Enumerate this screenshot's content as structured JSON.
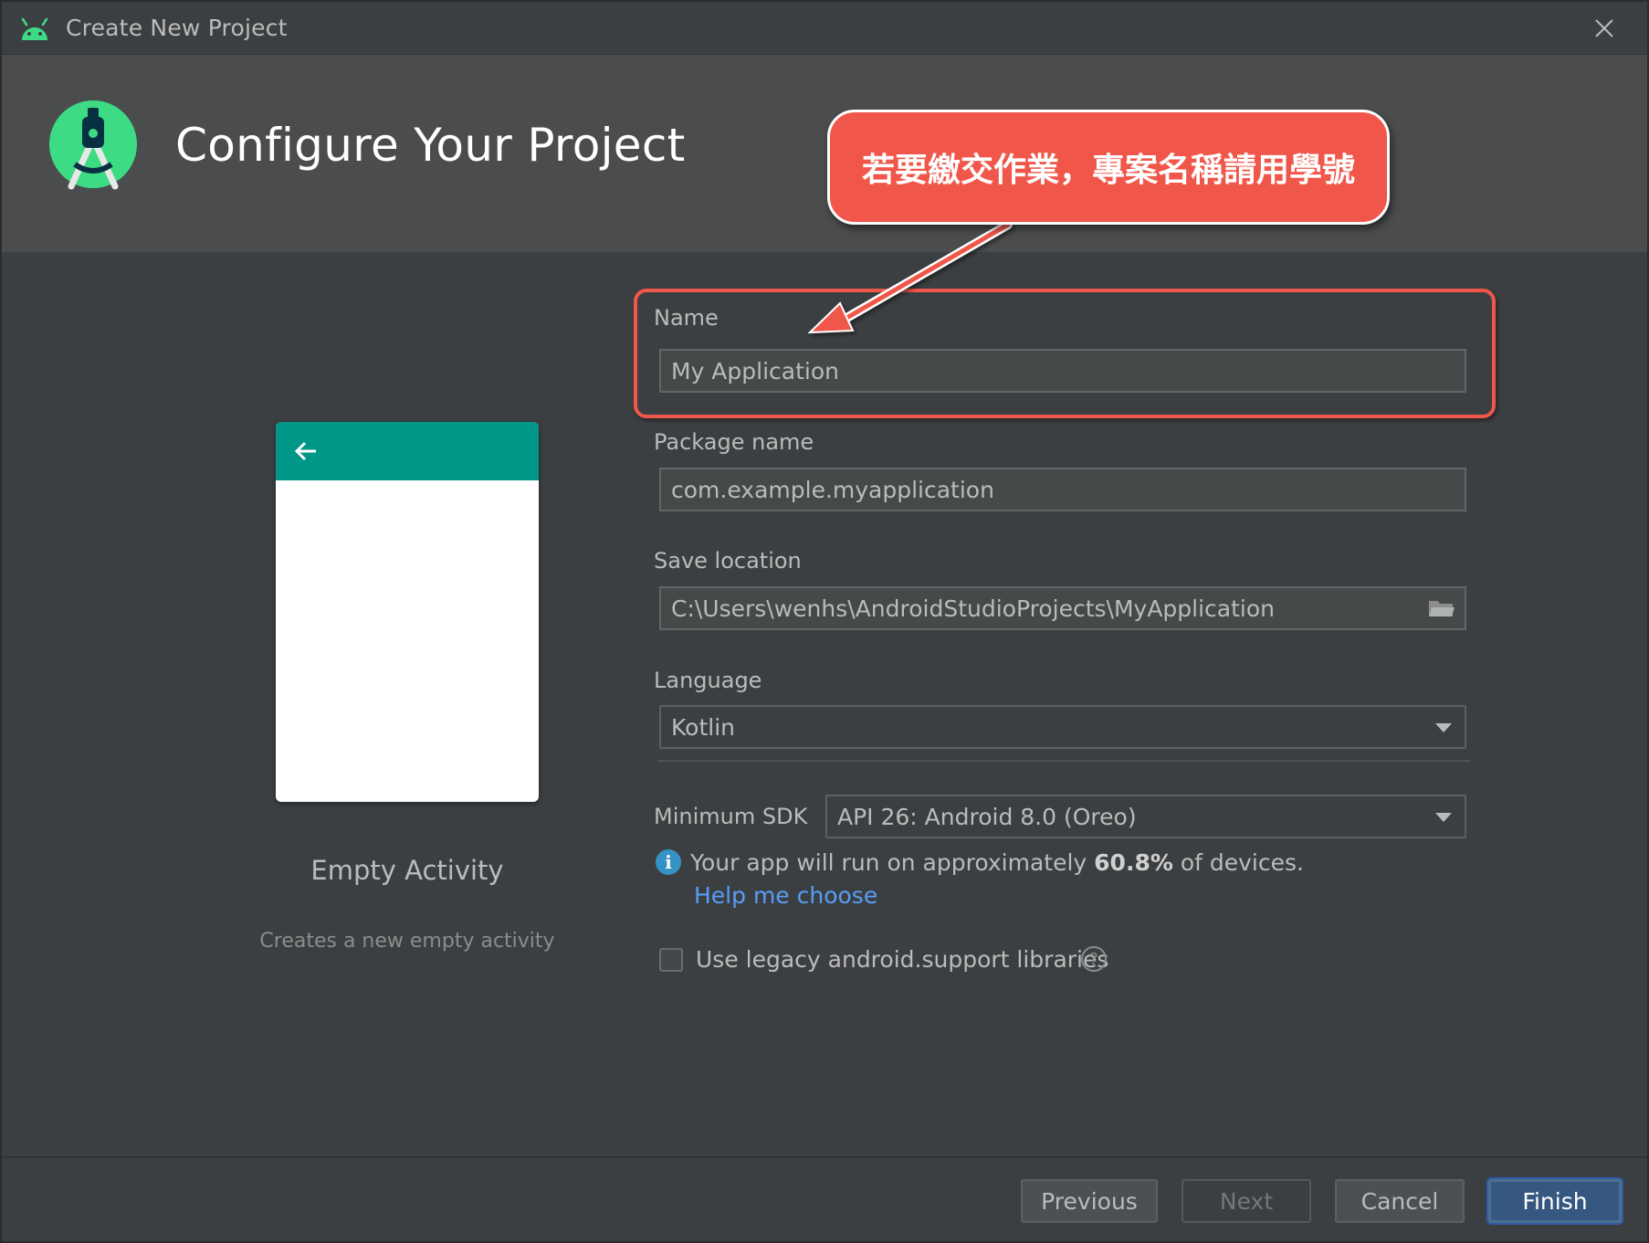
{
  "window": {
    "title": "Create New Project"
  },
  "header": {
    "heading": "Configure Your Project"
  },
  "callout": {
    "text": "若要繳交作業，專案名稱請用學號",
    "color": "#f0574a"
  },
  "template_preview": {
    "appbar_color": "#009688",
    "activity_title": "Empty Activity",
    "activity_description": "Creates a new empty activity"
  },
  "form": {
    "name_label": "Name",
    "name_value": "My Application",
    "package_label": "Package name",
    "package_value": "com.example.myapplication",
    "save_location_label": "Save location",
    "save_location_value": "C:\\Users\\wenhs\\AndroidStudioProjects\\MyApplication",
    "language_label": "Language",
    "language_value": "Kotlin",
    "min_sdk_label": "Minimum SDK",
    "min_sdk_value": "API 26: Android 8.0 (Oreo)",
    "info_prefix": "Your app will run on approximately ",
    "info_percent": "60.8%",
    "info_suffix": " of devices.",
    "help_link": "Help me choose",
    "legacy_checkbox_label": "Use legacy android.support libraries",
    "legacy_checked": false
  },
  "footer": {
    "previous": "Previous",
    "next": "Next",
    "cancel": "Cancel",
    "finish": "Finish"
  },
  "icons": {
    "app": "android-icon",
    "logo": "android-studio-logo-icon",
    "close": "close-icon",
    "back": "arrow-left-icon",
    "folder": "folder-icon",
    "info": "info-icon",
    "help": "question-icon"
  }
}
